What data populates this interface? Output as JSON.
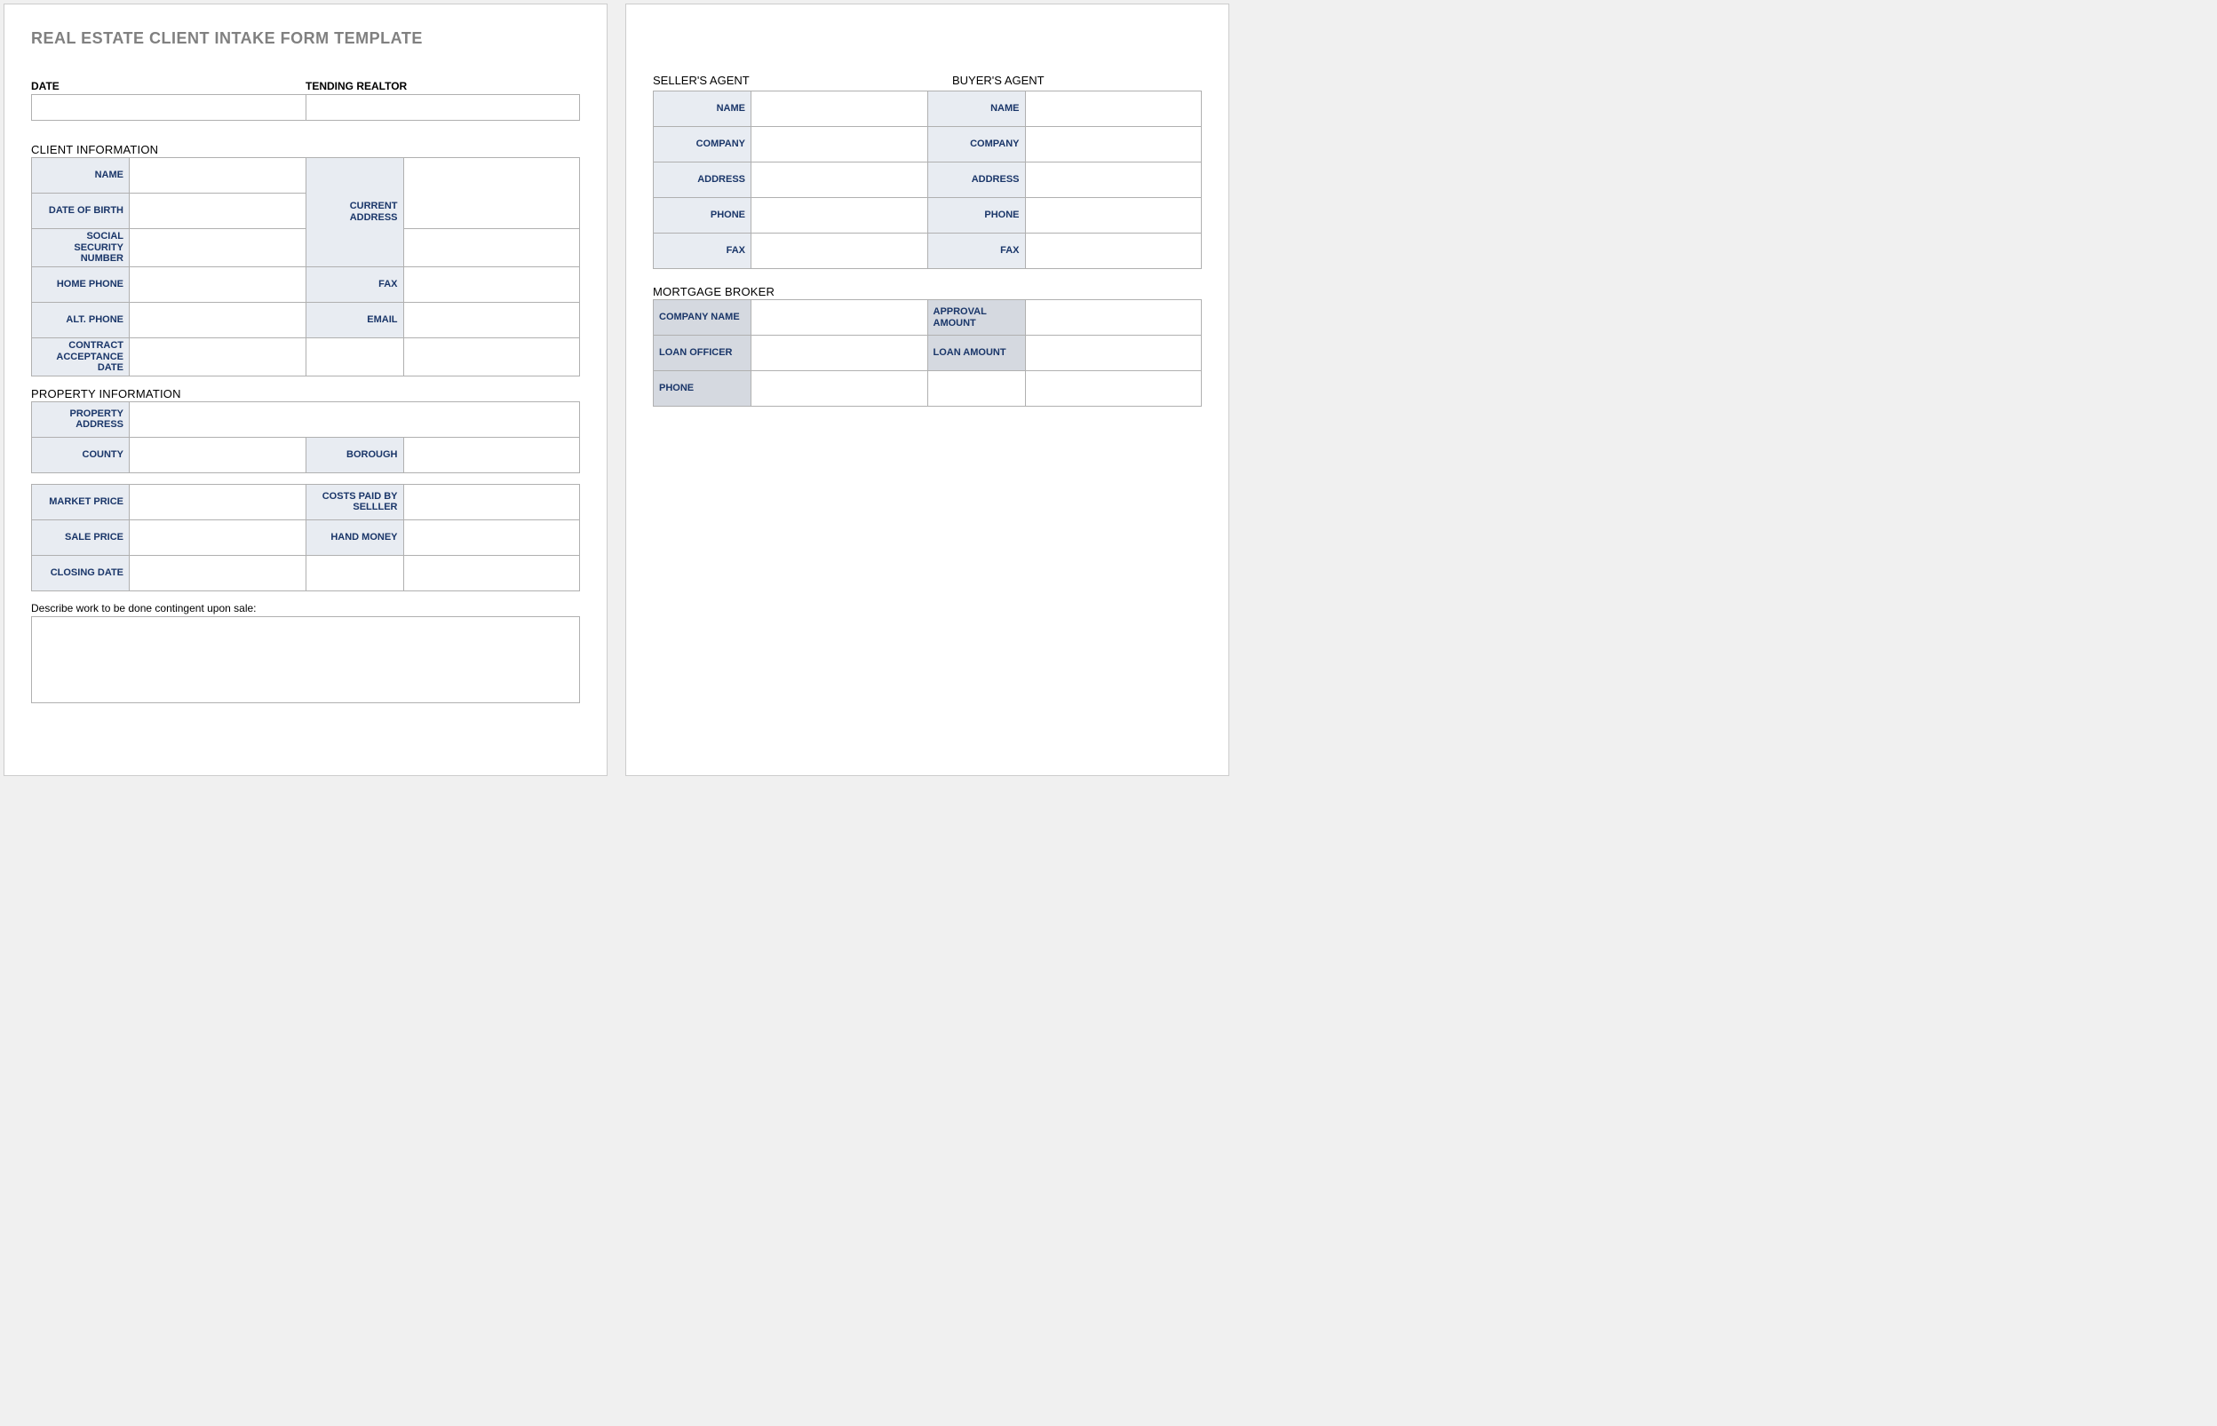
{
  "title": "REAL ESTATE CLIENT INTAKE FORM TEMPLATE",
  "header": {
    "date": "DATE",
    "tending": "TENDING REALTOR"
  },
  "client": {
    "section": "CLIENT INFORMATION",
    "name": "NAME",
    "dob": "DATE OF BIRTH",
    "ssn": "SOCIAL SECURITY NUMBER",
    "curaddr": "CURRENT ADDRESS",
    "homephone": "HOME PHONE",
    "fax": "FAX",
    "altphone": "ALT. PHONE",
    "email": "EMAIL",
    "contract": "CONTRACT ACCEPTANCE DATE"
  },
  "property": {
    "section": "PROPERTY INFORMATION",
    "addr": "PROPERTY ADDRESS",
    "county": "COUNTY",
    "borough": "BOROUGH",
    "market": "MARKET PRICE",
    "costs": "COSTS PAID BY SELLLER",
    "sale": "SALE PRICE",
    "hand": "HAND MONEY",
    "closing": "CLOSING DATE"
  },
  "describe": "Describe work to be done contingent upon sale:",
  "seller": {
    "section": "SELLER'S AGENT",
    "name": "NAME",
    "company": "COMPANY",
    "address": "ADDRESS",
    "phone": "PHONE",
    "fax": "FAX"
  },
  "buyer": {
    "section": "BUYER'S AGENT",
    "name": "NAME",
    "company": "COMPANY",
    "address": "ADDRESS",
    "phone": "PHONE",
    "fax": "FAX"
  },
  "broker": {
    "section": "MORTGAGE BROKER",
    "company": "COMPANY NAME",
    "approval": "APPROVAL AMOUNT",
    "officer": "LOAN OFFICER",
    "loan": "LOAN AMOUNT",
    "phone": "PHONE"
  }
}
